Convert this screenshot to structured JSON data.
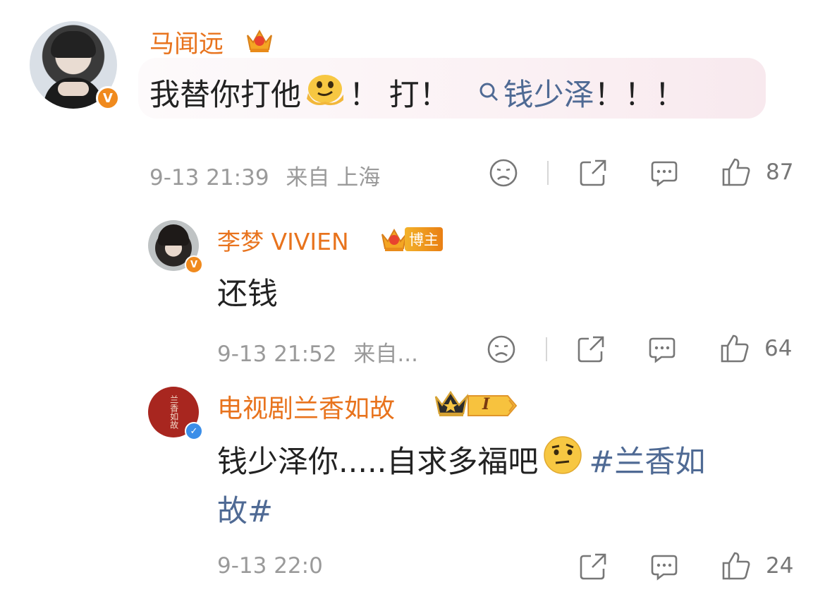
{
  "comments": [
    {
      "username": "马闻远",
      "text_before": "我替你打他",
      "text_mid": "！ 打！",
      "search_prefix": "Q",
      "search_link": "钱少泽",
      "text_after": "！！！",
      "time": "9-13 21:39",
      "location": "来自 上海",
      "likes": "87",
      "verified": "orange"
    },
    {
      "username": "李梦 VIVIEN",
      "badge": "博主",
      "text": "还钱",
      "time": "9-13 21:52",
      "location": "来自...",
      "likes": "64",
      "verified": "orange"
    },
    {
      "username": "电视剧兰香如故",
      "level_badge": "I",
      "text_before": "钱少泽你.....自求多福吧",
      "hashtag_line1": "#兰香如",
      "hashtag_line2": "故#",
      "avatar_text": "兰香如故",
      "time": "9-13 22:0",
      "likes": "24",
      "verified": "blue"
    }
  ],
  "icons": [
    "sad-face-icon",
    "share-icon",
    "comment-icon",
    "thumbs-up-icon",
    "crown-icon",
    "search-icon"
  ],
  "colors": {
    "username": "#e8731d",
    "link": "#4f6a94",
    "meta": "#9a9a9a",
    "verified_orange": "#f08a1d",
    "verified_blue": "#3b8ee8",
    "avatar_red": "#a8261f"
  }
}
